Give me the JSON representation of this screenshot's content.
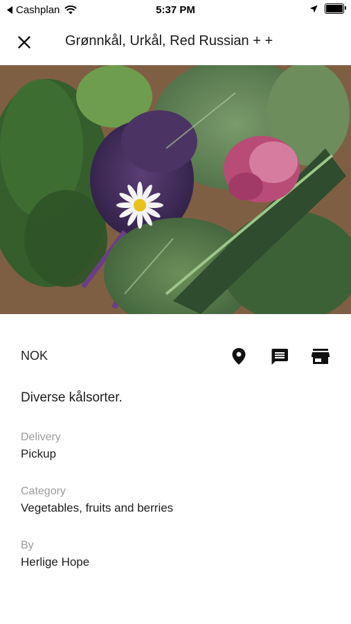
{
  "status": {
    "back_app": "Cashplan",
    "time": "5:37 PM"
  },
  "header": {
    "title": "Grønnkål, Urkål, Red Russian + +"
  },
  "listing": {
    "price": "NOK",
    "description": "Diverse kålsorter.",
    "fields": [
      {
        "label": "Delivery",
        "value": "Pickup"
      },
      {
        "label": "Category",
        "value": "Vegetables, fruits and berries"
      },
      {
        "label": "By",
        "value": "Herlige Hope"
      }
    ]
  },
  "icons": {
    "close": "close-icon",
    "location": "location-pin-icon",
    "message": "message-icon",
    "store": "store-icon"
  },
  "colors": {
    "text": "#1c1c1c",
    "label": "#9a9a9a",
    "background": "#ffffff"
  }
}
